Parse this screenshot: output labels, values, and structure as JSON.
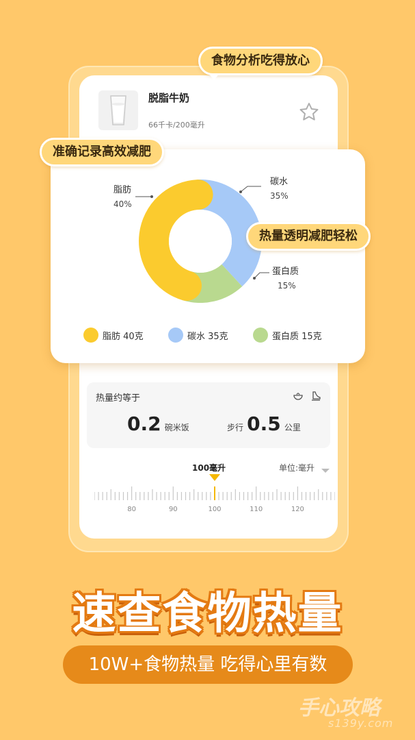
{
  "tags": {
    "top": "食物分析吃得放心",
    "left": "准确记录高效减肥",
    "right": "热量透明减肥轻松"
  },
  "food": {
    "name": "脱脂牛奶",
    "sub": "66千卡/200毫升",
    "icon": "milk-glass-icon",
    "favorite_icon": "star-icon"
  },
  "chart_data": {
    "type": "pie",
    "categories": [
      "脂肪",
      "碳水",
      "蛋白质"
    ],
    "values": [
      40,
      35,
      15
    ],
    "value_labels": [
      "40%",
      "35%",
      "15%"
    ],
    "colors": [
      "#FBCB2E",
      "#A6C9F7",
      "#B9D98F"
    ],
    "legend": [
      "脂肪 40克",
      "碳水 35克",
      "蛋白质 15克"
    ],
    "legend_position": "bottom"
  },
  "equal": {
    "title": "热量约等于",
    "rice_value": "0.2",
    "rice_unit": "碗米饭",
    "walk_prefix": "步行",
    "walk_value": "0.5",
    "walk_unit": "公里",
    "icons": [
      "bowl-icon",
      "shoe-icon"
    ]
  },
  "ruler": {
    "current": "100毫升",
    "unit_label": "单位:毫升",
    "ticks": [
      "80",
      "90",
      "100",
      "110",
      "120"
    ],
    "accent": "#F5B800"
  },
  "headline": "速查食物热量",
  "subline": "10W+食物热量 吃得心里有数",
  "watermark": {
    "main": "手心攻略",
    "sub": "s139y.com"
  }
}
